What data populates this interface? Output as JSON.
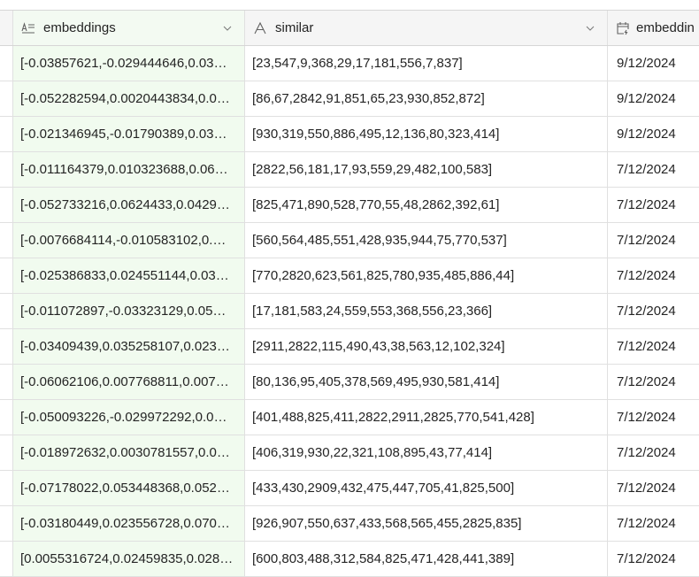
{
  "columns": [
    {
      "label": "embeddings",
      "icon": "long-text-icon"
    },
    {
      "label": "similar",
      "icon": "text-icon"
    },
    {
      "label": "embeddin",
      "icon": "calendar-icon"
    }
  ],
  "rows": [
    [
      "[-0.03857621,-0.029444646,0.03…",
      "[23,547,9,368,29,17,181,556,7,837]",
      "9/12/2024"
    ],
    [
      "[-0.052282594,0.0020443834,0.0…",
      "[86,67,2842,91,851,65,23,930,852,872]",
      "9/12/2024"
    ],
    [
      "[-0.021346945,-0.01790389,0.03…",
      "[930,319,550,886,495,12,136,80,323,414]",
      "9/12/2024"
    ],
    [
      "[-0.011164379,0.010323688,0.06…",
      "[2822,56,181,17,93,559,29,482,100,583]",
      "7/12/2024"
    ],
    [
      "[-0.052733216,0.0624433,0.0429…",
      "[825,471,890,528,770,55,48,2862,392,61]",
      "7/12/2024"
    ],
    [
      "[-0.0076684114,-0.010583102,0.…",
      "[560,564,485,551,428,935,944,75,770,537]",
      "7/12/2024"
    ],
    [
      "[-0.025386833,0.024551144,0.03…",
      "[770,2820,623,561,825,780,935,485,886,44]",
      "7/12/2024"
    ],
    [
      "[-0.011072897,-0.03323129,0.05…",
      "[17,181,583,24,559,553,368,556,23,366]",
      "7/12/2024"
    ],
    [
      "[-0.03409439,0.035258107,0.023…",
      "[2911,2822,115,490,43,38,563,12,102,324]",
      "7/12/2024"
    ],
    [
      "[-0.06062106,0.007768811,0.007…",
      "[80,136,95,405,378,569,495,930,581,414]",
      "7/12/2024"
    ],
    [
      "[-0.050093226,-0.029972292,0.0…",
      "[401,488,825,411,2822,2911,2825,770,541,428]",
      "7/12/2024"
    ],
    [
      "[-0.018972632,0.0030781557,0.0…",
      "[406,319,930,22,321,108,895,43,77,414]",
      "7/12/2024"
    ],
    [
      "[-0.07178022,0.053448368,0.052…",
      "[433,430,2909,432,475,447,705,41,825,500]",
      "7/12/2024"
    ],
    [
      "[-0.03180449,0.023556728,0.070…",
      "[926,907,550,637,433,568,565,455,2825,835]",
      "7/12/2024"
    ],
    [
      "[0.0055316724,0.02459835,0.028…",
      "[600,803,488,312,584,825,471,428,441,389]",
      "7/12/2024"
    ]
  ]
}
